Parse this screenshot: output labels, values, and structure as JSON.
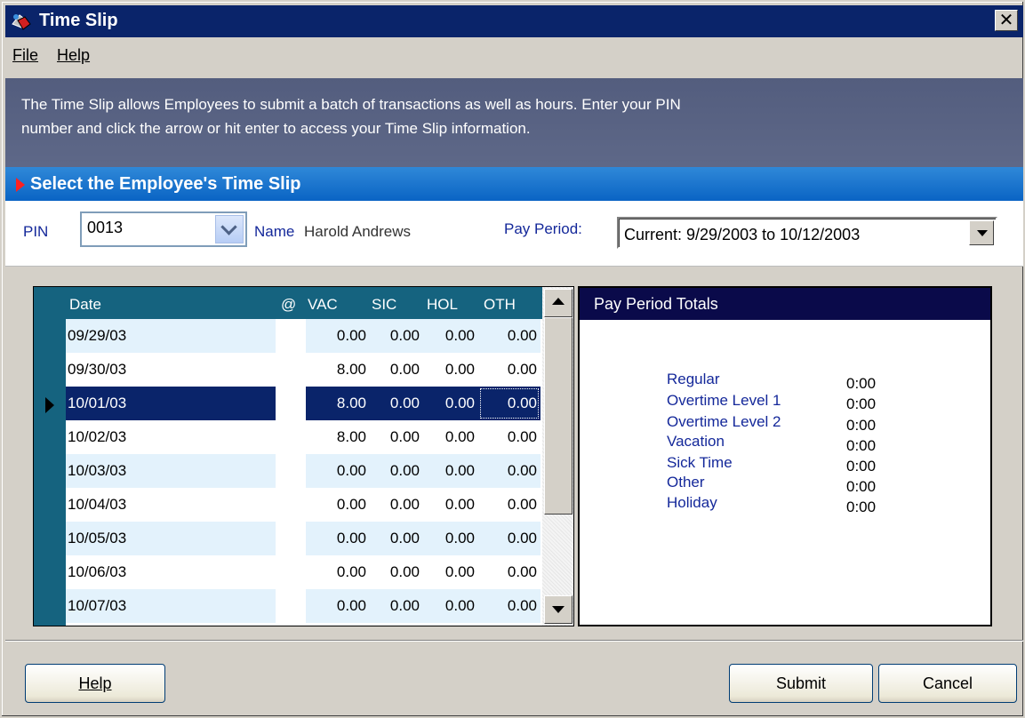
{
  "window": {
    "title": "Time Slip"
  },
  "menu": {
    "file": "File",
    "help": "Help"
  },
  "info": {
    "line1": "The Time Slip allows Employees to submit a batch of transactions as well as hours.  Enter your PIN",
    "line2": "number and click the arrow or hit enter to access your Time Slip information."
  },
  "section": {
    "title": "Select the Employee's Time Slip"
  },
  "form": {
    "pin_label": "PIN",
    "pin_value": "0013",
    "name_label": "Name",
    "name_value": "Harold Andrews",
    "pay_period_label": "Pay Period:",
    "pay_period_value": "Current:  9/29/2003 to 10/12/2003"
  },
  "grid": {
    "columns": [
      "Date",
      "@",
      "VAC",
      "SIC",
      "HOL",
      "OTH"
    ],
    "rows": [
      {
        "date": "09/29/03",
        "vac": "0.00",
        "sic": "0.00",
        "hol": "0.00",
        "oth": "0.00"
      },
      {
        "date": "09/30/03",
        "vac": "8.00",
        "sic": "0.00",
        "hol": "0.00",
        "oth": "0.00"
      },
      {
        "date": "10/01/03",
        "vac": "8.00",
        "sic": "0.00",
        "hol": "0.00",
        "oth": "0.00"
      },
      {
        "date": "10/02/03",
        "vac": "8.00",
        "sic": "0.00",
        "hol": "0.00",
        "oth": "0.00"
      },
      {
        "date": "10/03/03",
        "vac": "0.00",
        "sic": "0.00",
        "hol": "0.00",
        "oth": "0.00"
      },
      {
        "date": "10/04/03",
        "vac": "0.00",
        "sic": "0.00",
        "hol": "0.00",
        "oth": "0.00"
      },
      {
        "date": "10/05/03",
        "vac": "0.00",
        "sic": "0.00",
        "hol": "0.00",
        "oth": "0.00"
      },
      {
        "date": "10/06/03",
        "vac": "0.00",
        "sic": "0.00",
        "hol": "0.00",
        "oth": "0.00"
      },
      {
        "date": "10/07/03",
        "vac": "0.00",
        "sic": "0.00",
        "hol": "0.00",
        "oth": "0.00"
      }
    ],
    "selected_row_index": 2
  },
  "totals": {
    "title": "Pay Period Totals",
    "items": [
      {
        "label": "Regular",
        "value": "0:00"
      },
      {
        "label": "Overtime Level 1",
        "value": "0:00"
      },
      {
        "label": "Overtime Level 2",
        "value": "0:00"
      },
      {
        "label": "Vacation",
        "value": "0:00"
      },
      {
        "label": "Sick Time",
        "value": "0:00"
      },
      {
        "label": "Other",
        "value": "0:00"
      },
      {
        "label": "Holiday",
        "value": "0:00"
      }
    ]
  },
  "buttons": {
    "help": "Help",
    "submit": "Submit",
    "cancel": "Cancel"
  },
  "colors": {
    "title_bar": "#0a246a",
    "section_bar": "#0a64c4",
    "grid_header": "#15637f",
    "selected_row": "#0a246a",
    "label_blue": "#14289a",
    "alt_row": "#e3f2fc"
  }
}
